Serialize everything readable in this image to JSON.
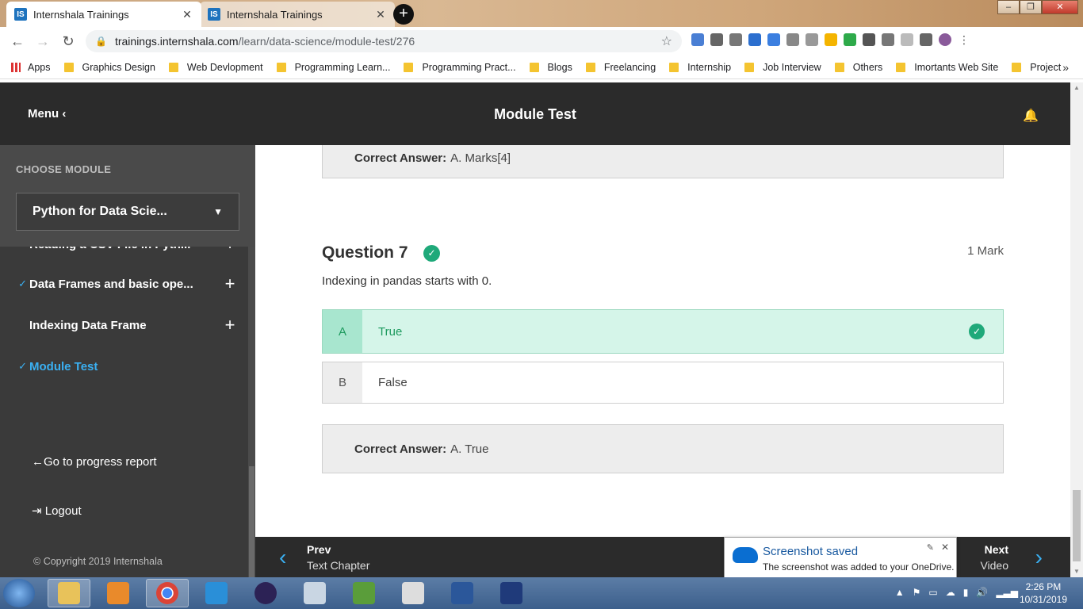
{
  "browser": {
    "tabs": [
      {
        "favicon": "IS",
        "title": "Internshala Trainings"
      },
      {
        "favicon": "IS",
        "title": "Internshala Trainings"
      }
    ],
    "url_host": "trainings.internshala.com",
    "url_path": "/learn/data-science/module-test/276",
    "bookmarks": [
      "Apps",
      "Graphics Design",
      "Web Devlopment",
      "Programming Learn...",
      "Programming Pract...",
      "Blogs",
      "Freelancing",
      "Internship",
      "Job Interview",
      "Others",
      "Imortants Web Site",
      "Project"
    ]
  },
  "header": {
    "menu_label": "Menu",
    "page_title": "Module Test"
  },
  "sidebar": {
    "choose_label": "CHOOSE MODULE",
    "selected_module": "Python for Data Scie...",
    "items": [
      {
        "label": "Reading a CSV File in Pyth...",
        "checked": true
      },
      {
        "label": "Data Frames and basic ope...",
        "checked": true
      },
      {
        "label": "Indexing Data Frame",
        "checked": false
      },
      {
        "label": "Module Test",
        "checked": true
      }
    ],
    "progress_link": "Go to progress report",
    "logout": "Logout",
    "copyright": "Copyright 2019 Internshala"
  },
  "prev_answer": {
    "label": "Correct Answer:",
    "value": "A. Marks[4]"
  },
  "question": {
    "title": "Question 7",
    "marks": "1 Mark",
    "text": "Indexing in pandas starts with 0.",
    "options": [
      {
        "letter": "A",
        "text": "True",
        "correct": true
      },
      {
        "letter": "B",
        "text": "False",
        "correct": false
      }
    ],
    "answer_label": "Correct Answer:",
    "answer_value": "A. True"
  },
  "bottom_nav": {
    "prev_label": "Prev",
    "prev_sub": "Text Chapter",
    "next_label": "Next",
    "next_sub": "Video"
  },
  "toast": {
    "title": "Screenshot saved",
    "message": "The screenshot was added to your OneDrive."
  },
  "taskbar": {
    "time": "2:26 PM",
    "date": "10/31/2019"
  }
}
